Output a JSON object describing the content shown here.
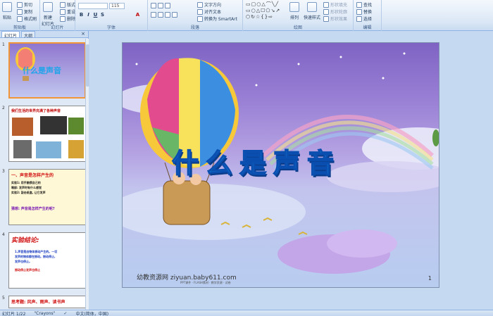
{
  "ribbon": {
    "groups": [
      {
        "label": "剪贴板"
      },
      {
        "label": "幻灯片"
      },
      {
        "label": "字体"
      },
      {
        "label": "段落"
      },
      {
        "label": "绘图"
      },
      {
        "label": "编辑"
      }
    ],
    "paste_label": "粘贴",
    "clipboard_items": [
      "剪切",
      "复制",
      "格式刷"
    ],
    "new_slide_label": "新建\n幻灯片",
    "slide_items": [
      "版式",
      "重设",
      "删除"
    ],
    "font_size": "115",
    "paragraph_items": [
      "文字方向",
      "对齐文本",
      "转换为 SmartArt"
    ],
    "arrange_label": "排列",
    "quick_styles_label": "快速样式",
    "shape_items": [
      "形状填充",
      "形状轮廓",
      "形状效果"
    ],
    "editing_items": [
      "查找",
      "替换",
      "选择"
    ],
    "format_buttons": [
      "B",
      "I",
      "U",
      "S",
      "A"
    ]
  },
  "panel": {
    "tabs": [
      "幻灯片",
      "大纲"
    ],
    "close_glyph": "×",
    "slides": [
      {
        "num": "1",
        "title": "什么是声音"
      },
      {
        "num": "2",
        "title": "我们生活的世界充满了各种声音"
      },
      {
        "num": "3",
        "title": "一、声音是怎样产生的",
        "lines": [
          "实验1: 用手触摸自己的",
          "喉部: 发声时有什么感觉",
          "实验2: 敲击纸盒, 让它发声",
          "猜想: 声音是怎样产生的呢?"
        ]
      },
      {
        "num": "4",
        "title": "实验结论:",
        "lines": [
          "1.声音是由物体振动产生的。一切",
          "发声的物体都在振动。振动停止,",
          "发声也停止。",
          "振动停止发声也停止"
        ]
      },
      {
        "num": "5",
        "title": "思考题: 风声、雨声、读书声"
      }
    ]
  },
  "slide": {
    "title": "什么是声音",
    "watermark": "幼教资源网 ziyuan.baby611.com",
    "subtext": "PPT课件 · FLASH素材 · 教学资源 · 试卷",
    "page_number": "1"
  },
  "status": {
    "slide_pos": "幻灯片 1/22",
    "theme": "\"Crayons\"",
    "language": "中文(简体，中国)"
  }
}
